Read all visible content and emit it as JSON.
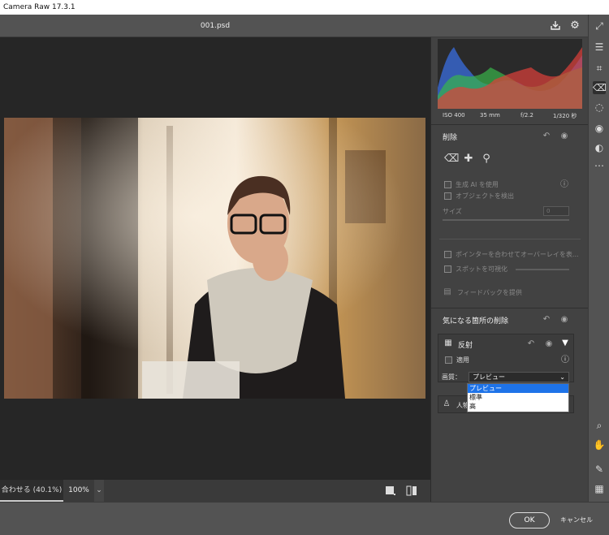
{
  "window": {
    "title": "Camera Raw 17.3.1"
  },
  "header": {
    "filename": "001.psd",
    "icons": [
      "save-icon",
      "gear-icon",
      "fullscreen-icon"
    ]
  },
  "histogram": {
    "meta": {
      "iso": "ISO 400",
      "focal": "35 mm",
      "aperture": "f/2.2",
      "shutter": "1/320 秒"
    },
    "colors": {
      "red": "#e0403a",
      "green": "#39b54a",
      "blue": "#3a6ee0"
    }
  },
  "remove_panel": {
    "title": "削除",
    "tools": [
      "eraser-icon",
      "bandage-icon",
      "stamp-icon"
    ],
    "gen_ai_label": "生成 AI を使用",
    "detect_objects_label": "オブジェクトを検出",
    "size_label": "サイズ",
    "size_value": "0",
    "overlay_label": "ポインターを合わせてオーバーレイを表...",
    "visualize_spots_label": "スポットを可視化",
    "feedback_label": "フィードバックを提供"
  },
  "distractions_panel": {
    "title": "気になる箇所の削除",
    "reflections": {
      "title": "反射",
      "apply_label": "適用",
      "quality_label": "画質：",
      "quality_value": "プレビュー",
      "options": [
        "プレビュー",
        "標準",
        "高"
      ],
      "selected_option": "プレビュー"
    },
    "people": {
      "title": "人物"
    }
  },
  "zoom": {
    "fit_label": "合わせる (40.1%)",
    "percent": "100%"
  },
  "footer": {
    "ok_label": "OK",
    "cancel_label": "キャンセル"
  },
  "tool_strip": [
    "adjust-sliders-icon",
    "crop-icon",
    "eraser-icon",
    "mask-icon",
    "redeye-icon",
    "presets-icon",
    "more-icon",
    "zoom-icon",
    "hand-icon",
    "color-sampler-icon",
    "grid-icon"
  ],
  "accent": "#1e73e8"
}
